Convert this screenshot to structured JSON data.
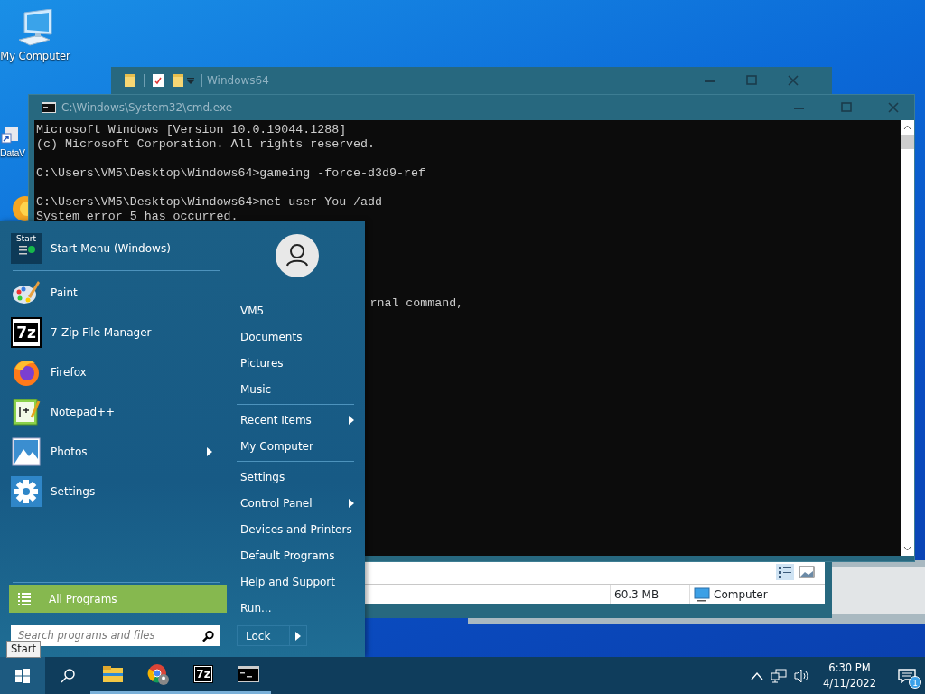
{
  "desktop_icons": [
    {
      "label": "My Computer"
    },
    {
      "label": "DataV"
    }
  ],
  "explorer_window": {
    "title": "Windows64",
    "status_size": "60.3 MB",
    "status_location": "Computer"
  },
  "cmd_window": {
    "title": "C:\\Windows\\System32\\cmd.exe",
    "blocks": [
      [
        "Microsoft Windows [Version 10.0.19044.1288]",
        "(c) Microsoft Corporation. All rights reserved."
      ],
      [
        "C:\\Users\\VM5\\Desktop\\Windows64>gameing -force-d3d9-ref"
      ],
      [
        "C:\\Users\\VM5\\Desktop\\Windows64>net user You /add",
        "System error 5 has occurred."
      ]
    ],
    "obscured_fragment": "rnal command,"
  },
  "start_menu": {
    "header": {
      "label": "Start Menu (Windows)",
      "icon_text": "Start"
    },
    "programs": [
      {
        "label": "Paint",
        "submenu": false
      },
      {
        "label": "7-Zip File Manager",
        "submenu": false,
        "icon_text": "7z"
      },
      {
        "label": "Firefox",
        "submenu": false
      },
      {
        "label": "Notepad++",
        "submenu": false
      },
      {
        "label": "Photos",
        "submenu": true
      },
      {
        "label": "Settings",
        "submenu": false
      }
    ],
    "all_programs": "All Programs",
    "search": {
      "placeholder": "Search programs and files"
    },
    "user_links": [
      {
        "label": "VM5",
        "submenu": false,
        "separator_before": false
      },
      {
        "label": "Documents",
        "submenu": false,
        "separator_before": false
      },
      {
        "label": "Pictures",
        "submenu": false,
        "separator_before": false
      },
      {
        "label": "Music",
        "submenu": false,
        "separator_before": false
      },
      {
        "label": "Recent Items",
        "submenu": true,
        "separator_before": true
      },
      {
        "label": "My Computer",
        "submenu": false,
        "separator_before": false
      },
      {
        "label": "Settings",
        "submenu": false,
        "separator_before": true
      },
      {
        "label": "Control Panel",
        "submenu": true,
        "separator_before": false
      },
      {
        "label": "Devices and Printers",
        "submenu": false,
        "separator_before": false
      },
      {
        "label": "Default Programs",
        "submenu": false,
        "separator_before": false
      },
      {
        "label": "Help and Support",
        "submenu": false,
        "separator_before": false
      },
      {
        "label": "Run...",
        "submenu": false,
        "separator_before": false
      }
    ],
    "power_button": "Lock"
  },
  "start_tooltip": "Start",
  "taskbar": {
    "apps": [
      {
        "running": true
      },
      {
        "running": true
      },
      {
        "running": true,
        "icon_text": "7z"
      },
      {
        "running": true
      }
    ],
    "time": "6:30 PM",
    "date": "4/11/2022",
    "notification_count": "1"
  }
}
